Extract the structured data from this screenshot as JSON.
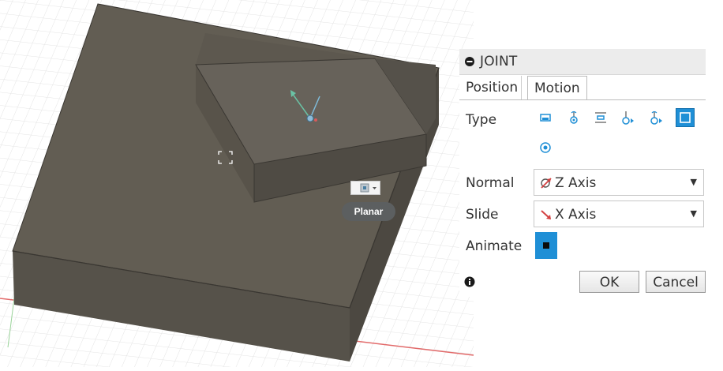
{
  "panel": {
    "title": "JOINT",
    "tabs": [
      {
        "label": "Position",
        "active": false
      },
      {
        "label": "Motion",
        "active": true
      }
    ],
    "type": {
      "label": "Type",
      "options": [
        "rigid-icon",
        "revolute-icon",
        "slider-icon",
        "cylindrical-icon",
        "pin-slot-icon",
        "planar-icon"
      ],
      "selected": "planar-icon",
      "second_row": [
        "ball-icon"
      ]
    },
    "normal": {
      "label": "Normal",
      "value": "Z Axis"
    },
    "slide": {
      "label": "Slide",
      "value": "X Axis"
    },
    "animate": {
      "label": "Animate"
    },
    "ok_label": "OK",
    "cancel_label": "Cancel"
  },
  "viewport": {
    "tooltip": "Planar"
  },
  "colors": {
    "accent": "#1f8fd6",
    "model": "#605b50",
    "grid": "#e4e4e4"
  }
}
